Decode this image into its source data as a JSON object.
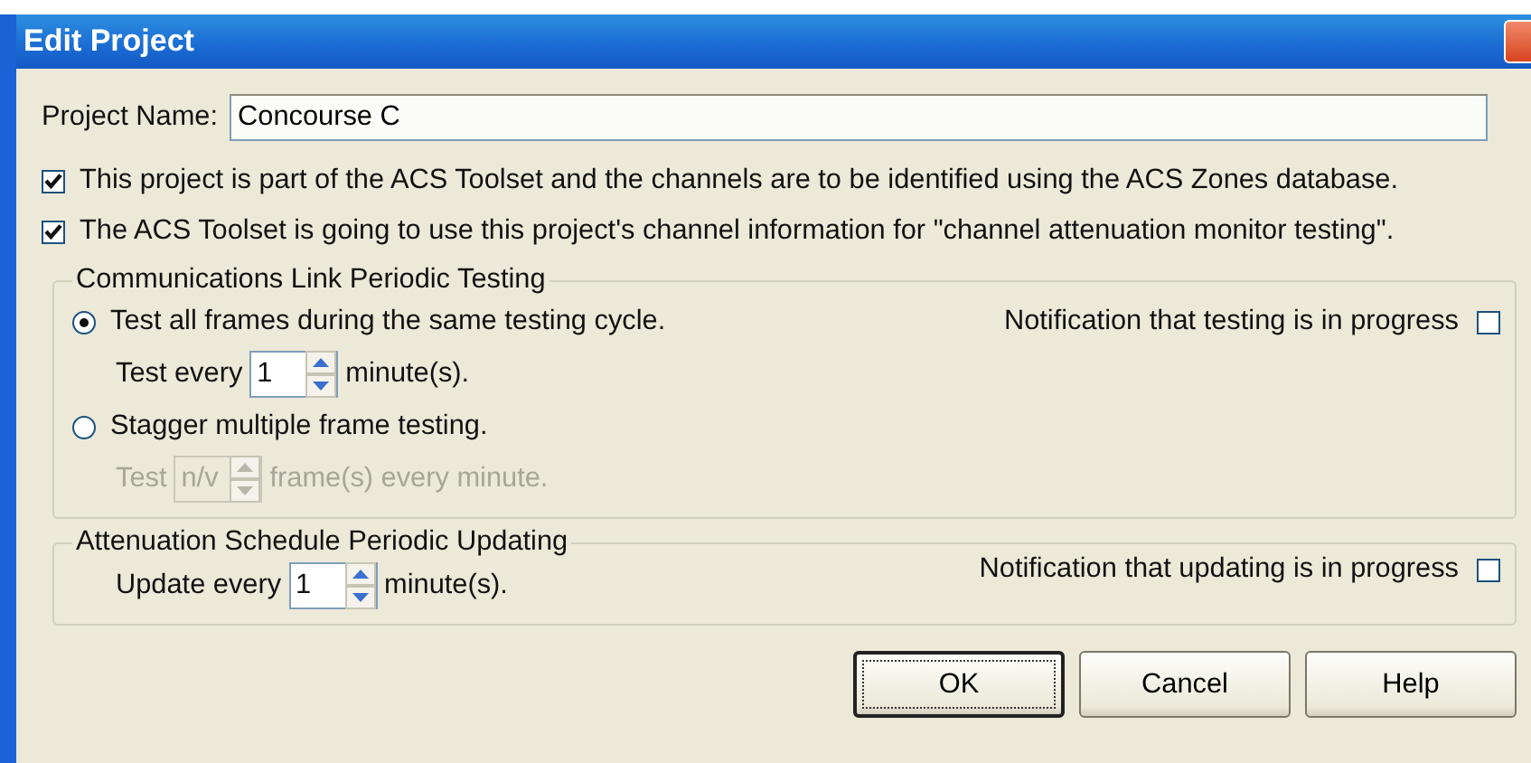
{
  "window": {
    "title": "Edit Project"
  },
  "project_name": {
    "label": "Project Name:",
    "value": "Concourse C"
  },
  "options": [
    {
      "label": "This project is part of the ACS Toolset and the channels are to be identified using the ACS Zones database.",
      "checked": true
    },
    {
      "label": "The ACS Toolset is going to use this project's channel information for \"channel attenuation monitor testing\".",
      "checked": true
    }
  ],
  "testing_group": {
    "title": "Communications Link Periodic Testing",
    "notification": {
      "label": "Notification that testing is in progress",
      "checked": false
    },
    "modes": [
      {
        "label": "Test all frames during the same testing cycle.",
        "selected": true,
        "detail": {
          "prefix": "Test every",
          "value": "1",
          "suffix": "minute(s).",
          "disabled": false
        }
      },
      {
        "label": "Stagger multiple frame testing.",
        "selected": false,
        "detail": {
          "prefix": "Test",
          "value": "n/v",
          "suffix": "frame(s) every minute.",
          "disabled": true
        }
      }
    ]
  },
  "updating_group": {
    "title": "Attenuation Schedule Periodic Updating",
    "prefix": "Update every",
    "value": "1",
    "suffix": "minute(s).",
    "notification": {
      "label": "Notification that updating is in progress",
      "checked": false
    }
  },
  "buttons": [
    {
      "label": "OK",
      "default": true
    },
    {
      "label": "Cancel",
      "default": false
    },
    {
      "label": "Help",
      "default": false
    }
  ]
}
